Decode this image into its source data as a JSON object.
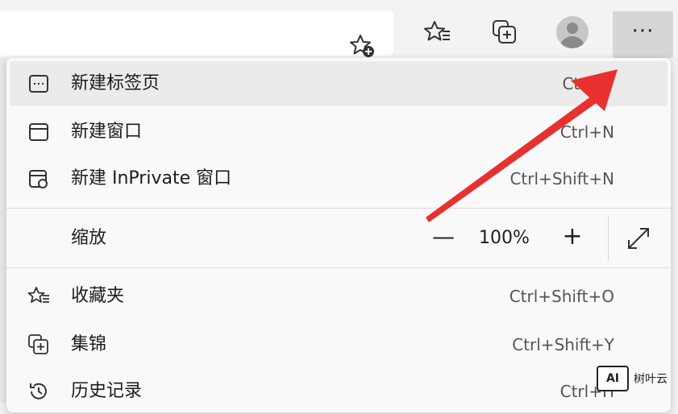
{
  "toolbar": {
    "more_label": "···"
  },
  "menu": {
    "items": [
      {
        "label": "新建标签页",
        "shortcut": "Ctrl+T",
        "icon": "new-tab-icon"
      },
      {
        "label": "新建窗口",
        "shortcut": "Ctrl+N",
        "icon": "new-window-icon"
      },
      {
        "label": "新建 InPrivate 窗口",
        "shortcut": "Ctrl+Shift+N",
        "icon": "inprivate-window-icon"
      },
      {
        "label": "收藏夹",
        "shortcut": "Ctrl+Shift+O",
        "icon": "favorites-icon"
      },
      {
        "label": "集锦",
        "shortcut": "Ctrl+Shift+Y",
        "icon": "collections-icon"
      },
      {
        "label": "历史记录",
        "shortcut": "Ctrl+H",
        "icon": "history-icon"
      }
    ],
    "zoom": {
      "label": "缩放",
      "minus": "—",
      "value": "100%",
      "plus": "+"
    }
  },
  "watermark": {
    "logo": "AI",
    "text": "树叶云"
  },
  "colors": {
    "arrow": "#e8302e",
    "menu_bg": "#f9f9f9",
    "active_item": "#ebebeb",
    "more_button_bg": "#d6d6d6"
  }
}
